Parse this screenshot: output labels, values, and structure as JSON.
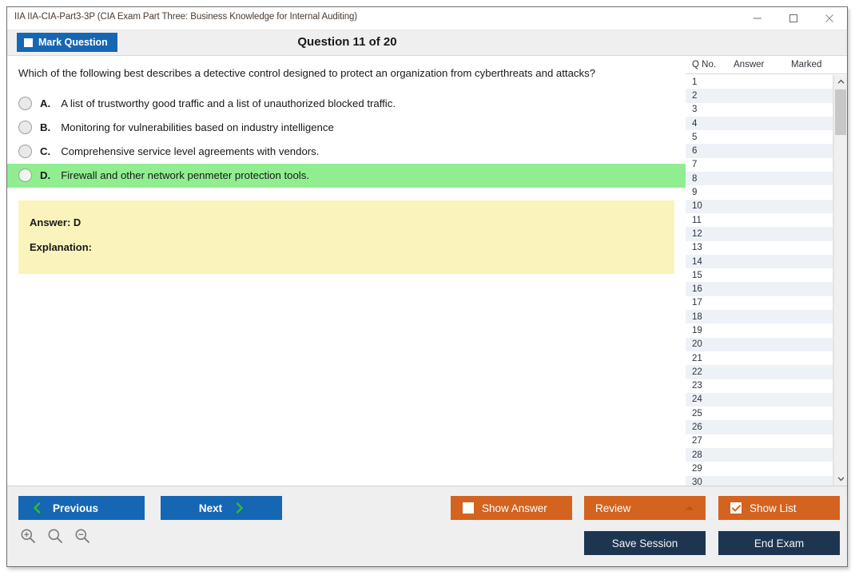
{
  "window": {
    "title": "IIA IIA-CIA-Part3-3P (CIA Exam Part Three: Business Knowledge for Internal Auditing)",
    "controls": {
      "minimize": "minimize-icon",
      "maximize": "maximize-icon",
      "close": "close-icon"
    }
  },
  "subheader": {
    "mark_question_label": "Mark Question",
    "mark_question_checked": false,
    "question_counter": "Question 11 of 20"
  },
  "question": {
    "text": "Which of the following best describes a detective control designed to protect an organization from cyberthreats and attacks?",
    "options": [
      {
        "letter": "A.",
        "text": "A list of trustworthy good traffic and a list of unauthorized blocked traffic.",
        "correct": false,
        "selected": false
      },
      {
        "letter": "B.",
        "text": "Monitoring for vulnerabilities based on industry intelligence",
        "correct": false,
        "selected": false
      },
      {
        "letter": "C.",
        "text": "Comprehensive service level agreements with vendors.",
        "correct": false,
        "selected": false
      },
      {
        "letter": "D.",
        "text": "Firewall and other network penmeter protection tools.",
        "correct": true,
        "selected": false
      }
    ]
  },
  "answer_box": {
    "answer_line": "Answer: D",
    "explanation_line": "Explanation:",
    "background_color": "#faf3bb"
  },
  "question_list": {
    "headers": {
      "qno": "Q No.",
      "answer": "Answer",
      "marked": "Marked"
    },
    "rows": [
      {
        "qno": "1",
        "answer": "",
        "marked": ""
      },
      {
        "qno": "2",
        "answer": "",
        "marked": ""
      },
      {
        "qno": "3",
        "answer": "",
        "marked": ""
      },
      {
        "qno": "4",
        "answer": "",
        "marked": ""
      },
      {
        "qno": "5",
        "answer": "",
        "marked": ""
      },
      {
        "qno": "6",
        "answer": "",
        "marked": ""
      },
      {
        "qno": "7",
        "answer": "",
        "marked": ""
      },
      {
        "qno": "8",
        "answer": "",
        "marked": ""
      },
      {
        "qno": "9",
        "answer": "",
        "marked": ""
      },
      {
        "qno": "10",
        "answer": "",
        "marked": ""
      },
      {
        "qno": "11",
        "answer": "",
        "marked": ""
      },
      {
        "qno": "12",
        "answer": "",
        "marked": ""
      },
      {
        "qno": "13",
        "answer": "",
        "marked": ""
      },
      {
        "qno": "14",
        "answer": "",
        "marked": ""
      },
      {
        "qno": "15",
        "answer": "",
        "marked": ""
      },
      {
        "qno": "16",
        "answer": "",
        "marked": ""
      },
      {
        "qno": "17",
        "answer": "",
        "marked": ""
      },
      {
        "qno": "18",
        "answer": "",
        "marked": ""
      },
      {
        "qno": "19",
        "answer": "",
        "marked": ""
      },
      {
        "qno": "20",
        "answer": "",
        "marked": ""
      },
      {
        "qno": "21",
        "answer": "",
        "marked": ""
      },
      {
        "qno": "22",
        "answer": "",
        "marked": ""
      },
      {
        "qno": "23",
        "answer": "",
        "marked": ""
      },
      {
        "qno": "24",
        "answer": "",
        "marked": ""
      },
      {
        "qno": "25",
        "answer": "",
        "marked": ""
      },
      {
        "qno": "26",
        "answer": "",
        "marked": ""
      },
      {
        "qno": "27",
        "answer": "",
        "marked": ""
      },
      {
        "qno": "28",
        "answer": "",
        "marked": ""
      },
      {
        "qno": "29",
        "answer": "",
        "marked": ""
      },
      {
        "qno": "30",
        "answer": "",
        "marked": ""
      }
    ]
  },
  "footer": {
    "previous_label": "Previous",
    "next_label": "Next",
    "show_answer_label": "Show Answer",
    "show_answer_checked": false,
    "review_label": "Review",
    "show_list_label": "Show List",
    "show_list_checked": true,
    "save_session_label": "Save Session",
    "end_exam_label": "End Exam",
    "zoom_tools": [
      "zoom-in-icon",
      "zoom-reset-icon",
      "zoom-out-icon"
    ]
  },
  "colors": {
    "primary_blue": "#1667b3",
    "orange": "#d3631f",
    "navy": "#1d3550",
    "correct_green": "#90ee90",
    "answer_yellow": "#faf3bb",
    "chevron_green": "#2fbe2f"
  }
}
